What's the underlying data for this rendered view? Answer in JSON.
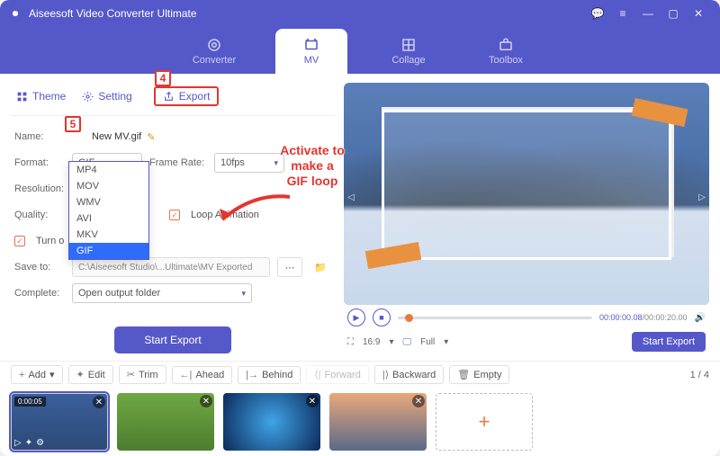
{
  "app": {
    "title": "Aiseesoft Video Converter Ultimate"
  },
  "nav": {
    "tabs": [
      "Converter",
      "MV",
      "Collage",
      "Toolbox"
    ]
  },
  "subtabs": {
    "theme": "Theme",
    "setting": "Setting",
    "export": "Export"
  },
  "callouts": {
    "c4": "4",
    "c5": "5",
    "hint": "Activate to\nmake a\nGIF loop"
  },
  "form": {
    "name_lbl": "Name:",
    "name_val": "New MV.gif",
    "format_lbl": "Format:",
    "format_val": "GIF",
    "framerate_lbl": "Frame Rate:",
    "framerate_val": "10fps",
    "resolution_lbl": "Resolution:",
    "quality_lbl": "Quality:",
    "loop_lbl": "Loop Animation",
    "gpu_lbl": "Turn o",
    "saveto_lbl": "Save to:",
    "saveto_val": "C:\\Aiseesoft Studio\\...Ultimate\\MV Exported",
    "complete_lbl": "Complete:",
    "complete_val": "Open output folder",
    "dropdown": [
      "MP4",
      "MOV",
      "WMV",
      "AVI",
      "MKV",
      "GIF"
    ],
    "start": "Start Export"
  },
  "player": {
    "time_cur": "00:00:00.08",
    "time_total": "00:00:20.00",
    "aspect": "16:9",
    "full": "Full",
    "start": "Start Export"
  },
  "toolbar": {
    "add": "Add",
    "edit": "Edit",
    "trim": "Trim",
    "ahead": "Ahead",
    "behind": "Behind",
    "forward": "Forward",
    "backward": "Backward",
    "empty": "Empty",
    "page": "1 / 4"
  },
  "thumbs": {
    "t1": "0:00:05"
  }
}
